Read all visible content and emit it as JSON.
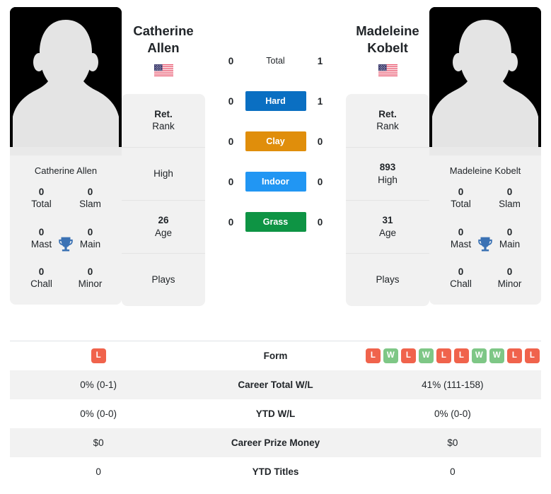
{
  "colors": {
    "hard": "#0a6fc2",
    "clay": "#e08e0b",
    "indoor": "#2196f3",
    "grass": "#0e9444",
    "loss": "#f0634c",
    "win": "#7ec786",
    "card_bg": "#f1f1f1",
    "row_stripe": "#f2f2f2",
    "trophy": "#3b72b4"
  },
  "left_player": {
    "first_name": "Catherine",
    "last_name": "Allen",
    "flag": "us-flag-icon",
    "photo": "player-photo-placeholder",
    "card_name": "Catherine Allen",
    "titles": [
      {
        "num": "0",
        "label": "Total"
      },
      {
        "num": "0",
        "label": "Slam"
      },
      {
        "num": "0",
        "label": "Mast"
      },
      {
        "num": "0",
        "label": "Main"
      },
      {
        "num": "0",
        "label": "Chall"
      },
      {
        "num": "0",
        "label": "Minor"
      }
    ],
    "info": [
      {
        "value": "Ret.",
        "label": "Rank"
      },
      {
        "value": "",
        "label": "High"
      },
      {
        "value": "26",
        "label": "Age"
      },
      {
        "value": "",
        "label": "Plays"
      }
    ]
  },
  "right_player": {
    "first_name": "Madeleine",
    "last_name": "Kobelt",
    "flag": "us-flag-icon",
    "photo": "player-photo-placeholder",
    "card_name": "Madeleine Kobelt",
    "titles": [
      {
        "num": "0",
        "label": "Total"
      },
      {
        "num": "0",
        "label": "Slam"
      },
      {
        "num": "0",
        "label": "Mast"
      },
      {
        "num": "0",
        "label": "Main"
      },
      {
        "num": "0",
        "label": "Chall"
      },
      {
        "num": "0",
        "label": "Minor"
      }
    ],
    "info": [
      {
        "value": "Ret.",
        "label": "Rank"
      },
      {
        "value": "893",
        "label": "High"
      },
      {
        "value": "31",
        "label": "Age"
      },
      {
        "value": "",
        "label": "Plays"
      }
    ]
  },
  "surfaces": [
    {
      "label": "Total",
      "left": "0",
      "right": "1",
      "color": "",
      "plain": true
    },
    {
      "label": "Hard",
      "left": "0",
      "right": "1",
      "color": "#0a6fc2",
      "plain": false
    },
    {
      "label": "Clay",
      "left": "0",
      "right": "0",
      "color": "#e08e0b",
      "plain": false
    },
    {
      "label": "Indoor",
      "left": "0",
      "right": "0",
      "color": "#2196f3",
      "plain": false
    },
    {
      "label": "Grass",
      "left": "0",
      "right": "0",
      "color": "#0e9444",
      "plain": false
    }
  ],
  "table": {
    "rows": [
      {
        "label": "Form",
        "left": "",
        "right": "",
        "type": "form"
      },
      {
        "label": "Career Total W/L",
        "left": "0% (0-1)",
        "right": "41% (111-158)",
        "type": "text"
      },
      {
        "label": "YTD W/L",
        "left": "0% (0-0)",
        "right": "0% (0-0)",
        "type": "text"
      },
      {
        "label": "Career Prize Money",
        "left": "$0",
        "right": "$0",
        "type": "text"
      },
      {
        "label": "YTD Titles",
        "left": "0",
        "right": "0",
        "type": "text"
      }
    ],
    "form_left": [
      "L"
    ],
    "form_right": [
      "L",
      "W",
      "L",
      "W",
      "L",
      "L",
      "W",
      "W",
      "L",
      "L"
    ]
  }
}
